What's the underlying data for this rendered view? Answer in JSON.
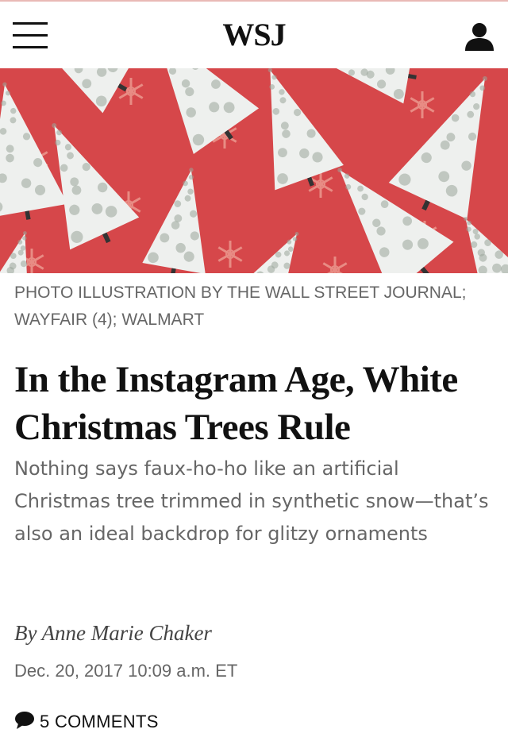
{
  "header": {
    "logo": "WSJ",
    "menu_icon": "hamburger-menu-icon",
    "account_icon": "user-icon"
  },
  "hero": {
    "alt": "Photo illustration of white flocked artificial Christmas trees on a red background with snowflakes",
    "background_color": "#d6474a"
  },
  "article": {
    "caption": "PHOTO ILLUSTRATION BY THE WALL STREET JOURNAL; WAYFAIR (4); WALMART",
    "headline": "In the Instagram Age, White Christmas Trees Rule",
    "dek": "Nothing says faux-ho-ho like an artificial Christmas tree trimmed in synthetic snow—that’s also an ideal backdrop for glitzy ornaments",
    "byline_prefix": "By",
    "author": "Anne Marie Chaker",
    "timestamp": "Dec. 20, 2017 10:09 a.m. ET",
    "comments_label": "5 COMMENTS",
    "comments_icon": "speech-bubble-icon"
  },
  "colors": {
    "accent_red": "#d6474a",
    "text_dark": "#111111",
    "text_gray": "#666666"
  }
}
